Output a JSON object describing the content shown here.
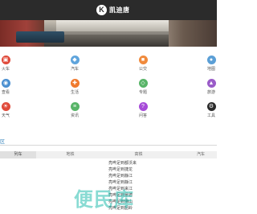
{
  "header": {
    "brand_logo_letter": "K",
    "brand_name": "凯迪唐",
    "bg_color": "#2b2b2b"
  },
  "categories": {
    "row1": [
      {
        "label": "火车",
        "icon": "train-icon",
        "color": "#e04a3a"
      },
      {
        "label": "汽车",
        "icon": "car-icon",
        "color": "#5fa4dc"
      },
      {
        "label": "公交",
        "icon": "bus-icon",
        "color": "#f08a3c"
      },
      {
        "label": "地图",
        "icon": "map-icon",
        "color": "#5b9fd6"
      }
    ],
    "row2": [
      {
        "label": "查看",
        "icon": "view-icon",
        "color": "#4a8fd0"
      },
      {
        "label": "生活",
        "icon": "life-icon",
        "color": "#f07a2e"
      },
      {
        "label": "专题",
        "icon": "topic-icon",
        "color": "#58b468"
      },
      {
        "label": "旅游",
        "icon": "travel-icon",
        "color": "#9a5cc8"
      }
    ],
    "row3": [
      {
        "label": "天气",
        "icon": "weather-icon",
        "color": "#e04a3a"
      },
      {
        "label": "资讯",
        "icon": "news-icon",
        "color": "#58b468"
      },
      {
        "label": "问答",
        "icon": "qa-icon",
        "color": "#a64bd8"
      },
      {
        "label": "工具",
        "icon": "tools-icon",
        "color": "#2b2b2b"
      }
    ]
  },
  "section": {
    "title": "区"
  },
  "tabs": [
    {
      "label": "列车",
      "active": true
    },
    {
      "label": "地铁",
      "active": false
    },
    {
      "label": "高铁",
      "active": false
    },
    {
      "label": "汽车",
      "active": false
    }
  ],
  "list": [
    "亮哔足到都沃来",
    "亮哔足到捷龙",
    "亮哔足到静江",
    "亮哔足到静江",
    "亮哔足到来江",
    "亮哔足到景德",
    "亮哔足到佛山",
    "亮哔足到韶岭"
  ],
  "watermark": "便民库"
}
